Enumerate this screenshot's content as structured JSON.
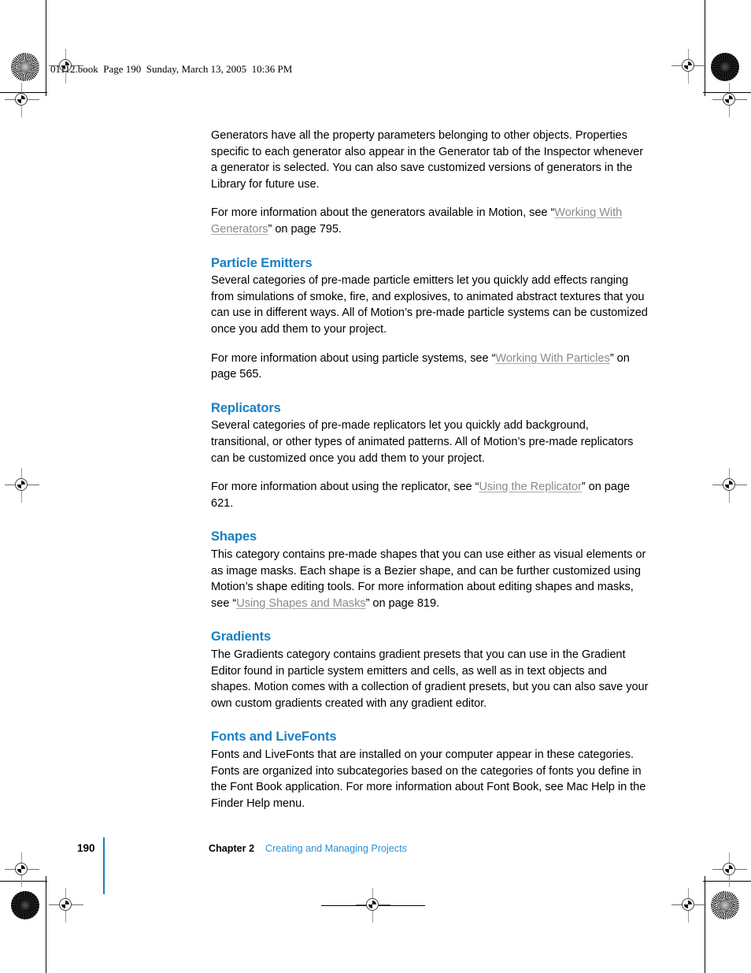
{
  "document": {
    "header_slug": "01112.book  Page 190  Sunday, March 13, 2005  10:36 PM",
    "accent_color": "#1a7fc1",
    "xref_color": "#8a8a8a"
  },
  "body": {
    "intro_paragraph": "Generators have all the property parameters belonging to other objects. Properties specific to each generator also appear in the Generator tab of the Inspector whenever a generator is selected. You can also save customized versions of generators in the Library for future use.",
    "intro_xref_lead": "For more information about the generators available in Motion, see “",
    "intro_xref_link": "Working With Generators",
    "intro_xref_tail": "” on page 795."
  },
  "sections": [
    {
      "heading": "Particle Emitters",
      "paragraph": "Several categories of pre-made particle emitters let you quickly add effects ranging from simulations of smoke, fire, and explosives, to animated abstract textures that you can use in different ways. All of Motion’s pre-made particle systems can be customized once you add them to your project.",
      "xref_lead": "For more information about using particle systems, see “",
      "xref_link": "Working With Particles",
      "xref_tail": "” on page 565."
    },
    {
      "heading": "Replicators",
      "paragraph": "Several categories of pre-made replicators let you quickly add background, transitional, or other types of animated patterns. All of Motion’s pre-made replicators can be customized once you add them to your project.",
      "xref_lead": "For more information about using the replicator, see “",
      "xref_link": "Using the Replicator",
      "xref_tail": "” on page 621."
    },
    {
      "heading": "Shapes",
      "paragraph_lead": "This category contains pre-made shapes that you can use either as visual elements or as image masks. Each shape is a Bezier shape, and can be further customized using Motion’s shape editing tools. For more information about editing shapes and masks, see “",
      "paragraph_link": "Using Shapes and Masks",
      "paragraph_tail": "” on page 819."
    },
    {
      "heading": "Gradients",
      "paragraph": "The Gradients category contains gradient presets that you can use in the Gradient Editor found in particle system emitters and cells, as well as in text objects and shapes. Motion comes with a collection of gradient presets, but you can also save your own custom gradients created with any gradient editor."
    },
    {
      "heading": "Fonts and LiveFonts",
      "paragraph": "Fonts and LiveFonts that are installed on your computer appear in these categories. Fonts are organized into subcategories based on the categories of fonts you define in the Font Book application. For more information about Font Book, see Mac Help in the Finder Help menu."
    }
  ],
  "footer": {
    "page_number": "190",
    "chapter_label": "Chapter 2",
    "chapter_title": "Creating and Managing Projects"
  }
}
